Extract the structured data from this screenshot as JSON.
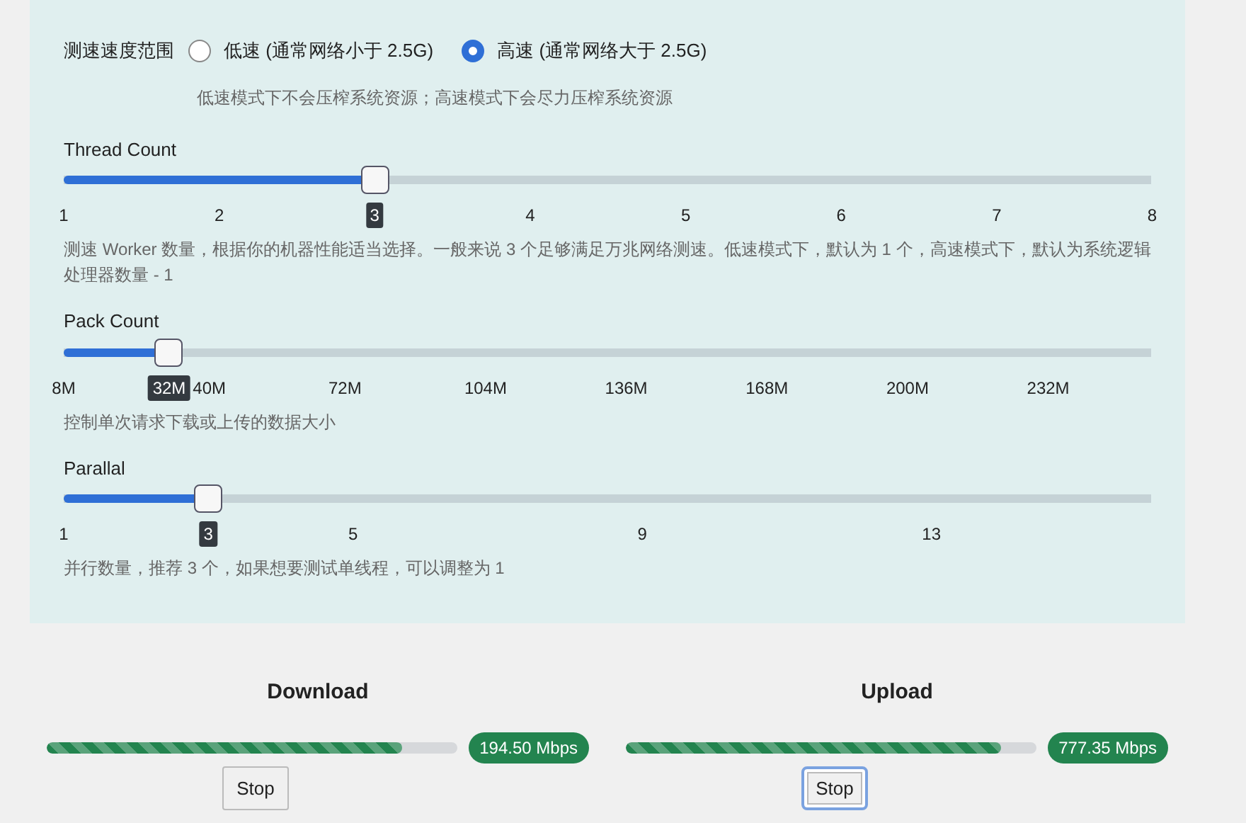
{
  "speed_range": {
    "label": "测速速度范围",
    "options": [
      {
        "label": "低速 (通常网络小于 2.5G)",
        "selected": false
      },
      {
        "label": "高速 (通常网络大于 2.5G)",
        "selected": true
      }
    ],
    "hint": "低速模式下不会压榨系统资源；高速模式下会尽力压榨系统资源"
  },
  "sliders": [
    {
      "label": "Thread Count",
      "value": "3",
      "level": 0.286,
      "ticks": [
        "1",
        "2",
        "4",
        "5",
        "6",
        "7",
        "8"
      ],
      "hint": "测速 Worker 数量，根据你的机器性能适当选择。一般来说 3 个足够满足万兆网络测速。低速模式下，默认为 1 个，高速模式下，默认为系统逻辑处理器数量 - 1"
    },
    {
      "label": "Pack Count",
      "value": "32M",
      "level": 0.097,
      "ticks": [
        "8M",
        "40M",
        "72M",
        "104M",
        "136M",
        "168M",
        "200M",
        "232M"
      ],
      "hint": "控制单次请求下载或上传的数据大小"
    },
    {
      "label": "Parallal",
      "value": "3",
      "level": 0.133,
      "ticks": [
        "1",
        "5",
        "9",
        "13"
      ],
      "hint": "并行数量，推荐 3 个，如果想要测试单线程，可以调整为 1"
    }
  ],
  "tests": [
    {
      "title": "Download",
      "level": 0.866,
      "speed": "194.50 Mbps",
      "button": "Stop",
      "focused": false
    },
    {
      "title": "Upload",
      "level": 0.914,
      "speed": "777.35 Mbps",
      "button": "Stop",
      "focused": true
    }
  ]
}
